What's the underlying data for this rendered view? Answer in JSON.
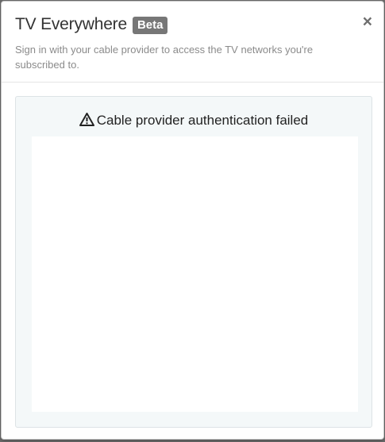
{
  "modal": {
    "title": "TV Everywhere",
    "badge": "Beta",
    "subtitle": "Sign in with your cable provider to access the TV networks you're subscribed to.",
    "close_label": "×"
  },
  "body": {
    "error_icon": "warning-icon",
    "error_message": "Cable provider authentication failed"
  },
  "colors": {
    "badge_bg": "#777777",
    "body_bg": "#f4f8f9",
    "title_text": "#333333",
    "subtitle_text": "#8b8b8b"
  }
}
